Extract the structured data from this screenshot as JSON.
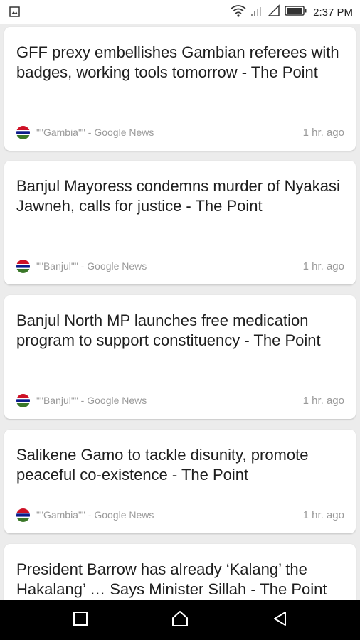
{
  "status_bar": {
    "time": "2:37 PM",
    "icons": [
      "image-notification-icon",
      "wifi-icon",
      "signal-icon",
      "no-signal-icon",
      "battery-icon"
    ]
  },
  "cards": [
    {
      "title": "GFF prexy embellishes Gambian referees with badges, working tools tomorrow - The Point",
      "source": "\"\"Gambia\"\" - Google News",
      "time": "1 hr. ago"
    },
    {
      "title": "Banjul Mayoress condemns murder of Nyakasi Jawneh, calls for justice - The Point",
      "source": "\"\"Banjul\"\" - Google News",
      "time": "1 hr. ago"
    },
    {
      "title": "Banjul North MP launches free medication program to support constituency - The Point",
      "source": "\"\"Banjul\"\" - Google News",
      "time": "1 hr. ago"
    },
    {
      "title": "Salikene Gamo to tackle disunity, promote peaceful co-existence - The Point",
      "source": "\"\"Gambia\"\" - Google News",
      "time": "1 hr. ago"
    },
    {
      "title": "President Barrow has already ‘Kalang’ the Hakalang’ … Says Minister Sillah - The Point",
      "source": "",
      "time": ""
    }
  ],
  "nav_bar": {
    "buttons": [
      "recents-square-icon",
      "home-house-icon",
      "back-triangle-icon"
    ]
  },
  "colors": {
    "flag_red": "#ce1126",
    "flag_blue": "#0c1c8c",
    "flag_green": "#3a7728",
    "text_primary": "#1e1e1e",
    "text_secondary": "#9a9a9a",
    "background": "#ececec"
  }
}
